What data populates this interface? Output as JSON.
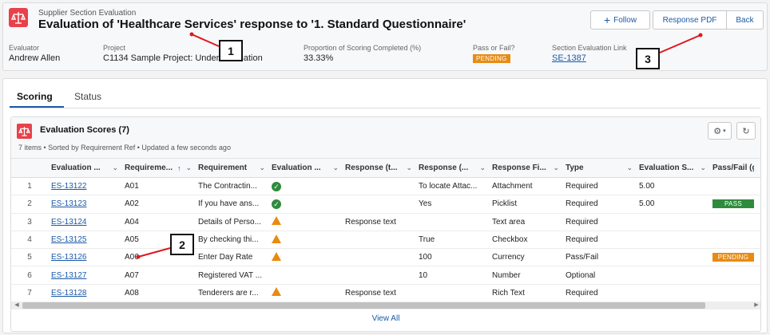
{
  "header": {
    "eyebrow": "Supplier Section Evaluation",
    "title": "Evaluation of 'Healthcare Services' response to '1. Standard Questionnaire'",
    "buttons": {
      "follow": "Follow",
      "response_pdf": "Response PDF",
      "back": "Back"
    }
  },
  "fields": {
    "evaluator_label": "Evaluator",
    "evaluator_value": "Andrew Allen",
    "project_label": "Project",
    "project_value": "C1134 Sample Project: Under Evaluation",
    "proportion_label": "Proportion of Scoring Completed (%)",
    "proportion_value": "33.33%",
    "pass_fail_label": "Pass or Fail?",
    "pass_fail_value": "PENDING",
    "section_link_label": "Section Evaluation Link",
    "section_link_value": "SE-1387"
  },
  "tabs": {
    "scoring": "Scoring",
    "status": "Status"
  },
  "card": {
    "title": "Evaluation Scores (7)",
    "subtitle": "7 items • Sorted by Requirement Ref • Updated a few seconds ago",
    "view_all": "View All"
  },
  "columns": [
    "Evaluation ...",
    "Requireme...",
    "Requirement",
    "Evaluation ...",
    "Response (t...",
    "Response (...",
    "Response Fi...",
    "Type",
    "Evaluation S...",
    "Pass/Fail (g..."
  ],
  "rows": [
    {
      "num": "1",
      "id": "ES-13122",
      "ref": "A01",
      "requirement": "The Contractin...",
      "status": "ok",
      "response_text": "",
      "response": "To locate Attac...",
      "field": "Attachment",
      "type": "Required",
      "score": "5.00",
      "pass_fail": ""
    },
    {
      "num": "2",
      "id": "ES-13123",
      "ref": "A02",
      "requirement": "If you have ans...",
      "status": "ok",
      "response_text": "",
      "response": "Yes",
      "field": "Picklist",
      "type": "Required",
      "score": "5.00",
      "pass_fail": "PASS"
    },
    {
      "num": "3",
      "id": "ES-13124",
      "ref": "A04",
      "requirement": "Details of Perso...",
      "status": "warn",
      "response_text": "Response text",
      "response": "",
      "field": "Text area",
      "type": "Required",
      "score": "",
      "pass_fail": ""
    },
    {
      "num": "4",
      "id": "ES-13125",
      "ref": "A05",
      "requirement": "By checking thi...",
      "status": "warn",
      "response_text": "",
      "response": "True",
      "field": "Checkbox",
      "type": "Required",
      "score": "",
      "pass_fail": ""
    },
    {
      "num": "5",
      "id": "ES-13126",
      "ref": "A06",
      "requirement": "Enter Day Rate",
      "status": "warn",
      "response_text": "",
      "response": "100",
      "field": "Currency",
      "type": "Pass/Fail",
      "score": "",
      "pass_fail": "PENDING"
    },
    {
      "num": "6",
      "id": "ES-13127",
      "ref": "A07",
      "requirement": "Registered VAT ...",
      "status": "",
      "response_text": "",
      "response": "10",
      "field": "Number",
      "type": "Optional",
      "score": "",
      "pass_fail": ""
    },
    {
      "num": "7",
      "id": "ES-13128",
      "ref": "A08",
      "requirement": "Tenderers are r...",
      "status": "warn",
      "response_text": "Response text",
      "response": "",
      "field": "Rich Text",
      "type": "Required",
      "score": "",
      "pass_fail": ""
    }
  ],
  "callouts": [
    "1",
    "2",
    "3"
  ],
  "colors": {
    "accent": "#1a5aa8",
    "brand": "#e8414a",
    "pass": "#2e8b3d",
    "pending": "#e88b13",
    "callout_line": "#e0161e"
  }
}
